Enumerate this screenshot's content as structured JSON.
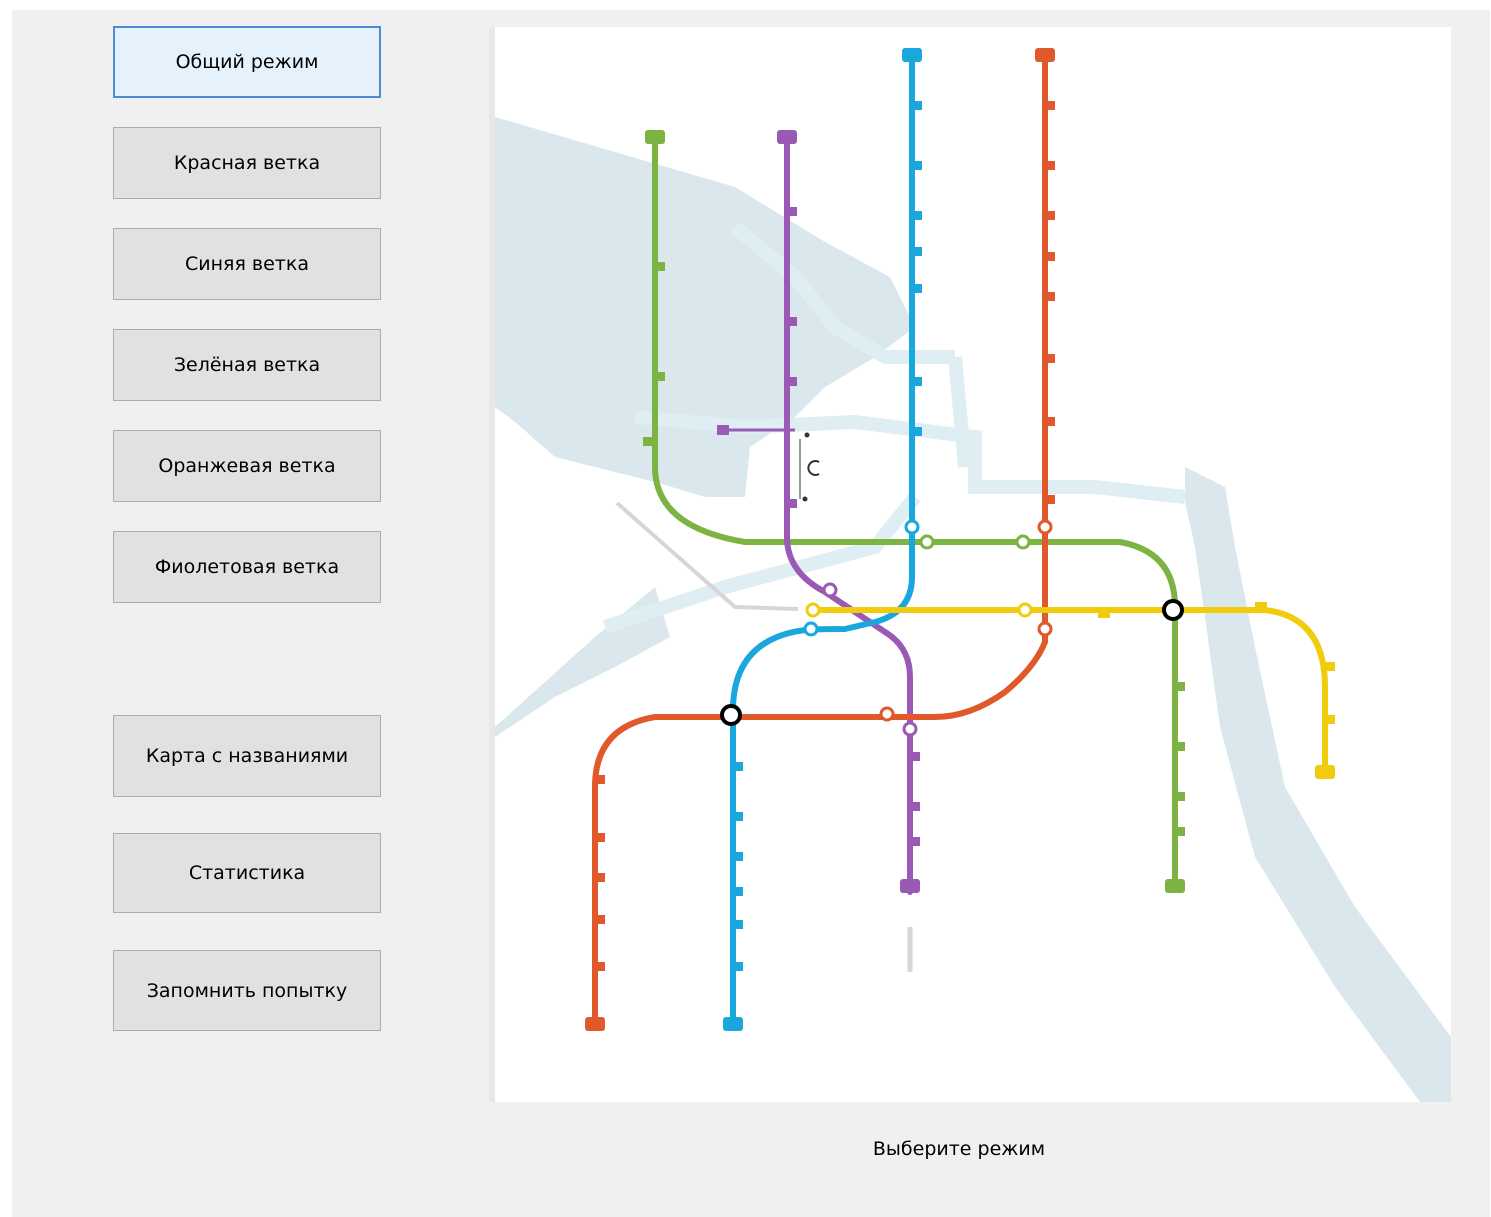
{
  "sidebar": {
    "modes": [
      {
        "label": "Общий режим",
        "active": true
      },
      {
        "label": "Красная ветка"
      },
      {
        "label": "Синяя ветка"
      },
      {
        "label": "Зелёная ветка"
      },
      {
        "label": "Оранжевая ветка"
      },
      {
        "label": "Фиолетовая ветка"
      }
    ],
    "actions": [
      {
        "label": "Карта с названиями"
      },
      {
        "label": "Статистика"
      },
      {
        "label": "Запомнить попытку"
      }
    ]
  },
  "status_text": "Выберите режим",
  "metro_map": {
    "line_colors": {
      "orange": "#e0592a",
      "blue": "#1aa7de",
      "green": "#7cb342",
      "purple": "#9b59b6",
      "yellow": "#f0cc0c",
      "river": "#d8e7ec"
    }
  }
}
